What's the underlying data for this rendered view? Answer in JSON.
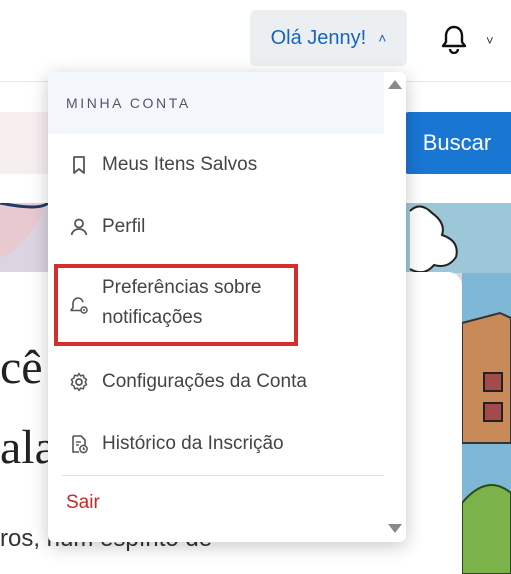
{
  "header": {
    "user_greeting": "Olá Jenny!",
    "notifications_icon": "bell-icon"
  },
  "search": {
    "button_label": "Buscar"
  },
  "hero": {
    "title_line1": "cê",
    "title_line2": "ala",
    "subtitle": "ros, num espírito de"
  },
  "menu": {
    "section_title": "MINHA CONTA",
    "items": [
      {
        "label": "Meus Itens Salvos",
        "icon": "bookmark-icon"
      },
      {
        "label": "Perfil",
        "icon": "user-icon"
      },
      {
        "label": "Preferências sobre notificações",
        "icon": "bell-settings-icon"
      },
      {
        "label": "Configurações da Conta",
        "icon": "gear-icon"
      },
      {
        "label": "Histórico da Inscrição",
        "icon": "history-document-icon"
      }
    ],
    "signout_label": "Sair"
  },
  "colors": {
    "accent": "#1976d2",
    "link_blue": "#1565c0",
    "signout_red": "#c62828",
    "highlight_red": "#d32f2f"
  }
}
